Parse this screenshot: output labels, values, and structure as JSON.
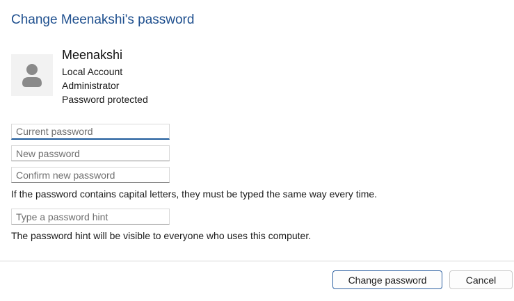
{
  "dialog": {
    "title": "Change Meenakshi's password"
  },
  "account": {
    "name": "Meenakshi",
    "type": "Local Account",
    "role": "Administrator",
    "status": "Password protected",
    "avatar_icon": "user-silhouette-icon"
  },
  "form": {
    "current_password_placeholder": "Current password",
    "new_password_placeholder": "New password",
    "confirm_password_placeholder": "Confirm new password",
    "caps_note": "If the password contains capital letters, they must be typed the same way every time.",
    "hint_placeholder": "Type a password hint",
    "hint_note": "The password hint will be visible to everyone who uses this computer."
  },
  "buttons": {
    "change_password": "Change password",
    "cancel": "Cancel"
  },
  "colors": {
    "title": "#1e4f8e",
    "focus_accent": "#1d5a9a",
    "primary_border": "#2b5fa0"
  }
}
